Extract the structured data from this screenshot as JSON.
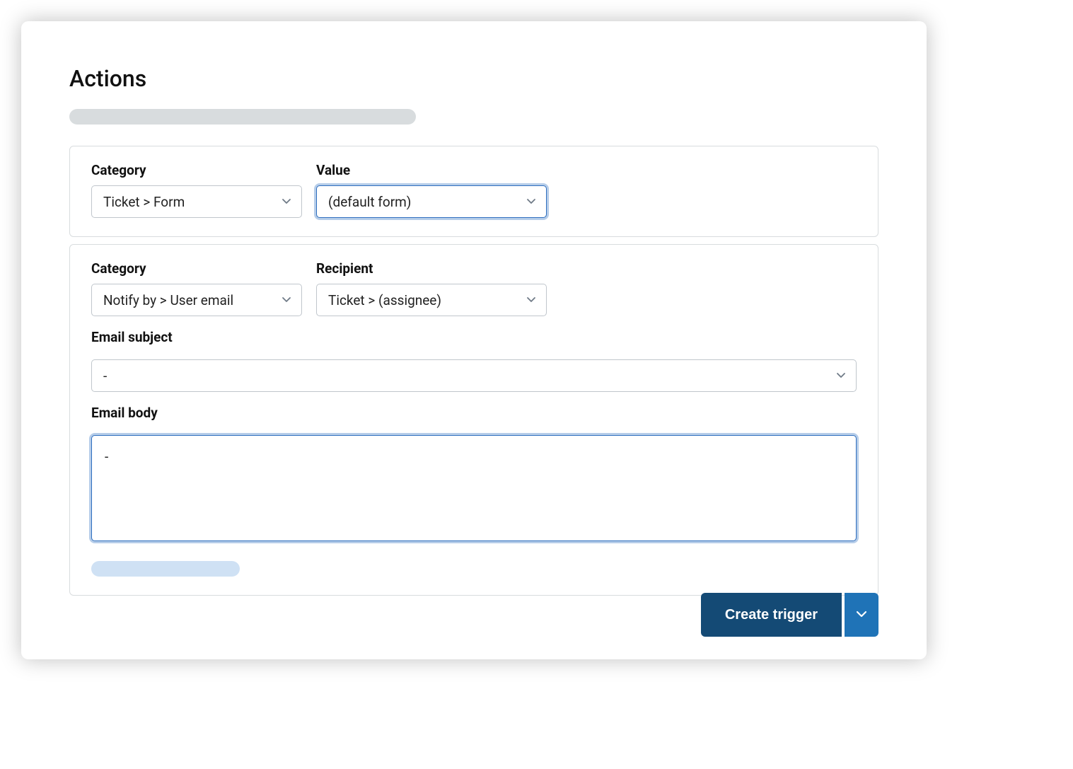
{
  "page": {
    "title": "Actions"
  },
  "actions": [
    {
      "fields": {
        "category": {
          "label": "Category",
          "value": "Ticket > Form"
        },
        "value": {
          "label": "Value",
          "value": "(default form)",
          "focused": true
        }
      }
    },
    {
      "fields": {
        "category": {
          "label": "Category",
          "value": "Notify by > User email"
        },
        "recipient": {
          "label": "Recipient",
          "value": "Ticket > (assignee)"
        }
      },
      "email_subject": {
        "label": "Email subject",
        "value": "-"
      },
      "email_body": {
        "label": "Email body",
        "value": "-",
        "focused": true
      }
    }
  ],
  "footer": {
    "create_label": "Create trigger"
  }
}
